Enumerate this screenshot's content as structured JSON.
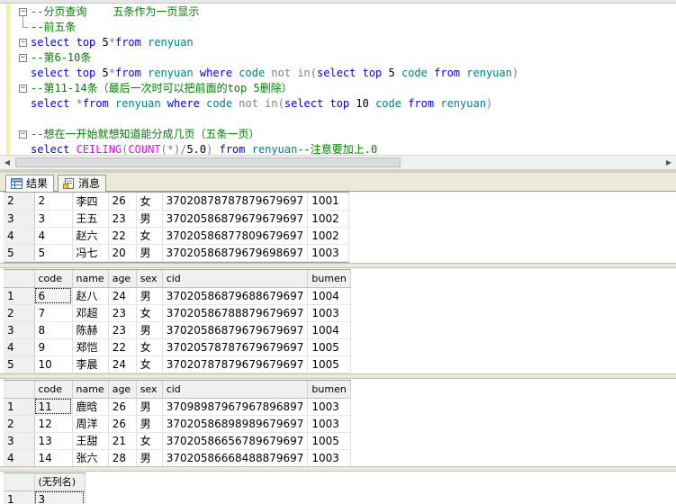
{
  "editor": {
    "lines": [
      {
        "fold": "minus",
        "segments": [
          {
            "c": "cm",
            "t": "--分页查询    五条作为一页显示"
          }
        ]
      },
      {
        "fold": "end",
        "segments": [
          {
            "c": "cm",
            "t": "--前五条"
          }
        ]
      },
      {
        "fold": "minus",
        "segments": [
          {
            "c": "kw",
            "t": "select"
          },
          {
            "c": "",
            "t": " "
          },
          {
            "c": "kw",
            "t": "top"
          },
          {
            "c": "",
            "t": " 5"
          },
          {
            "c": "gy",
            "t": "*"
          },
          {
            "c": "kw",
            "t": "from"
          },
          {
            "c": "",
            "t": " "
          },
          {
            "c": "ob",
            "t": "renyuan"
          }
        ]
      },
      {
        "fold": "minus",
        "segments": [
          {
            "c": "cm",
            "t": "--第6-10条"
          }
        ]
      },
      {
        "fold": "none",
        "segments": [
          {
            "c": "kw",
            "t": "select"
          },
          {
            "c": "",
            "t": " "
          },
          {
            "c": "kw",
            "t": "top"
          },
          {
            "c": "",
            "t": " 5"
          },
          {
            "c": "gy",
            "t": "*"
          },
          {
            "c": "kw",
            "t": "from"
          },
          {
            "c": "",
            "t": " "
          },
          {
            "c": "ob",
            "t": "renyuan"
          },
          {
            "c": "",
            "t": " "
          },
          {
            "c": "kw",
            "t": "where"
          },
          {
            "c": "",
            "t": " "
          },
          {
            "c": "ob",
            "t": "code"
          },
          {
            "c": "",
            "t": " "
          },
          {
            "c": "gy",
            "t": "not in"
          },
          {
            "c": "gy",
            "t": "("
          },
          {
            "c": "kw",
            "t": "select"
          },
          {
            "c": "",
            "t": " "
          },
          {
            "c": "kw",
            "t": "top"
          },
          {
            "c": "",
            "t": " 5 "
          },
          {
            "c": "ob",
            "t": "code"
          },
          {
            "c": "",
            "t": " "
          },
          {
            "c": "kw",
            "t": "from"
          },
          {
            "c": "",
            "t": " "
          },
          {
            "c": "ob",
            "t": "renyuan"
          },
          {
            "c": "gy",
            "t": ")"
          }
        ]
      },
      {
        "fold": "minus",
        "segments": [
          {
            "c": "cm",
            "t": "--第11-14条（最后一次时可以把前面的top 5删除）"
          }
        ]
      },
      {
        "fold": "none",
        "segments": [
          {
            "c": "kw",
            "t": "select"
          },
          {
            "c": "",
            "t": " "
          },
          {
            "c": "gy",
            "t": "*"
          },
          {
            "c": "kw",
            "t": "from"
          },
          {
            "c": "",
            "t": " "
          },
          {
            "c": "ob",
            "t": "renyuan"
          },
          {
            "c": "",
            "t": " "
          },
          {
            "c": "kw",
            "t": "where"
          },
          {
            "c": "",
            "t": " "
          },
          {
            "c": "ob",
            "t": "code"
          },
          {
            "c": "",
            "t": " "
          },
          {
            "c": "gy",
            "t": "not in"
          },
          {
            "c": "gy",
            "t": "("
          },
          {
            "c": "kw",
            "t": "select"
          },
          {
            "c": "",
            "t": " "
          },
          {
            "c": "kw",
            "t": "top"
          },
          {
            "c": "",
            "t": " 10 "
          },
          {
            "c": "ob",
            "t": "code"
          },
          {
            "c": "",
            "t": " "
          },
          {
            "c": "kw",
            "t": "from"
          },
          {
            "c": "",
            "t": " "
          },
          {
            "c": "ob",
            "t": "renyuan"
          },
          {
            "c": "gy",
            "t": ")"
          }
        ]
      },
      {
        "fold": "none",
        "segments": [
          {
            "c": "",
            "t": ""
          }
        ]
      },
      {
        "fold": "minus",
        "segments": [
          {
            "c": "cm",
            "t": "--想在一开始就想知道能分成几页（五条一页）"
          }
        ]
      },
      {
        "fold": "none",
        "segments": [
          {
            "c": "kw",
            "t": "select"
          },
          {
            "c": "",
            "t": " "
          },
          {
            "c": "fn",
            "t": "CEILING"
          },
          {
            "c": "gy",
            "t": "("
          },
          {
            "c": "fn",
            "t": "COUNT"
          },
          {
            "c": "gy",
            "t": "(*)"
          },
          {
            "c": "gy",
            "t": "/"
          },
          {
            "c": "",
            "t": "5.0"
          },
          {
            "c": "gy",
            "t": ")"
          },
          {
            "c": "",
            "t": " "
          },
          {
            "c": "kw",
            "t": "from"
          },
          {
            "c": "",
            "t": " "
          },
          {
            "c": "ob",
            "t": "renyuan"
          },
          {
            "c": "cm",
            "t": "--注意要加上.0"
          }
        ]
      }
    ]
  },
  "tabs": [
    {
      "label": "结果",
      "icon": "grid-icon",
      "active": true
    },
    {
      "label": "消息",
      "icon": "message-icon",
      "active": false
    }
  ],
  "results": [
    {
      "columns": [],
      "rows": [
        [
          "2",
          "2",
          "李四",
          "26",
          "女",
          "370208787878796796​97",
          "1001"
        ],
        [
          "3",
          "3",
          "王五",
          "23",
          "男",
          "37020586879679679697",
          "1002"
        ],
        [
          "4",
          "4",
          "赵六",
          "22",
          "女",
          "37020586877809679697",
          "1002"
        ],
        [
          "5",
          "5",
          "冯七",
          "20",
          "男",
          "37020586879679698697",
          "1003"
        ]
      ]
    },
    {
      "columns": [
        "code",
        "name",
        "age",
        "sex",
        "cid",
        "bumen"
      ],
      "rows": [
        [
          "1",
          "6",
          "赵八",
          "24",
          "男",
          "37020586879688679697",
          "1004"
        ],
        [
          "2",
          "7",
          "邓超",
          "23",
          "女",
          "37020586788879679697",
          "1003"
        ],
        [
          "3",
          "8",
          "陈赫",
          "23",
          "男",
          "37020586879679679697",
          "1004"
        ],
        [
          "4",
          "9",
          "郑恺",
          "22",
          "女",
          "37020578787679679697",
          "1005"
        ],
        [
          "5",
          "10",
          "李晨",
          "24",
          "女",
          "37020787879679679697",
          "1005"
        ]
      ]
    },
    {
      "columns": [
        "code",
        "name",
        "age",
        "sex",
        "cid",
        "bumen"
      ],
      "rows": [
        [
          "1",
          "11",
          "鹿晗",
          "26",
          "男",
          "37098987967967896897",
          "1003"
        ],
        [
          "2",
          "12",
          "周洋",
          "26",
          "男",
          "37020586898989679697",
          "1003"
        ],
        [
          "3",
          "13",
          "王甜",
          "21",
          "女",
          "37020586656789679697",
          "1005"
        ],
        [
          "4",
          "14",
          "张六",
          "28",
          "男",
          "37020586668488879697",
          "1003"
        ]
      ]
    },
    {
      "columns": [
        "(无列名)"
      ],
      "rows": [
        [
          "1",
          "3"
        ]
      ]
    }
  ]
}
